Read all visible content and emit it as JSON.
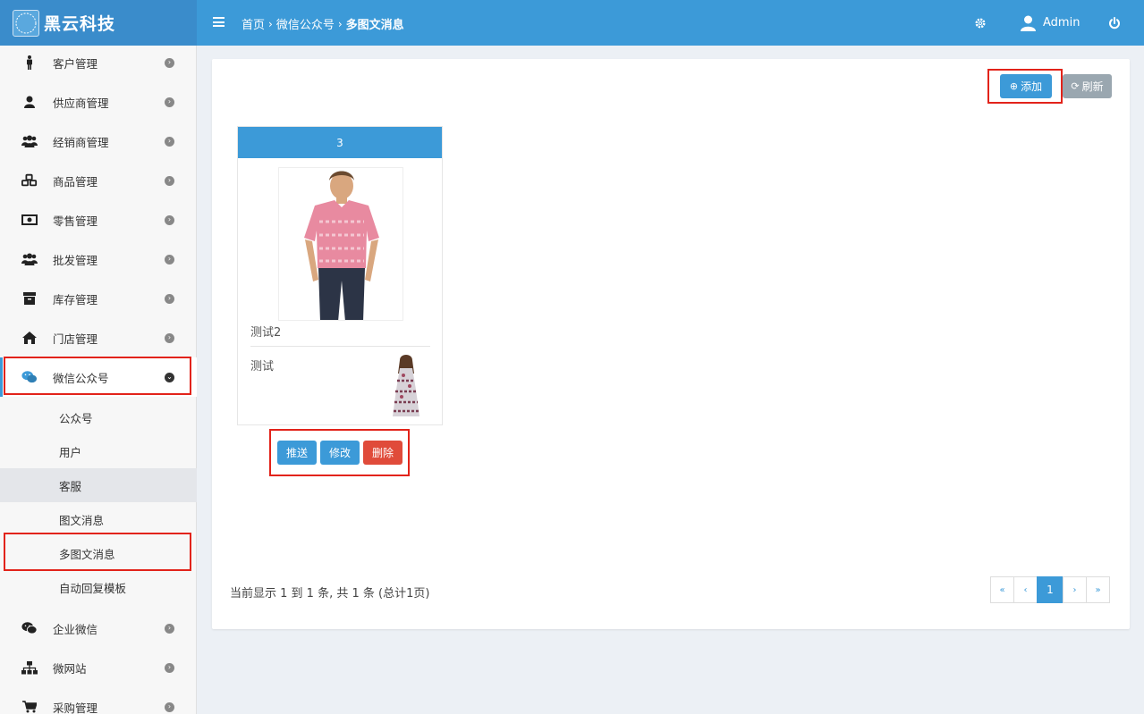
{
  "brand": {
    "logo_text": "黑云科技",
    "name": "黑云科技"
  },
  "header": {
    "breadcrumb": [
      "首页",
      "微信公众号",
      "多图文消息"
    ],
    "separator": "›",
    "user_name": "Admin"
  },
  "sidebar": {
    "items": [
      {
        "label": "客户管理",
        "icon": "male-icon"
      },
      {
        "label": "供应商管理",
        "icon": "user-icon"
      },
      {
        "label": "经销商管理",
        "icon": "users-icon"
      },
      {
        "label": "商品管理",
        "icon": "cubes-icon"
      },
      {
        "label": "零售管理",
        "icon": "money-icon"
      },
      {
        "label": "批发管理",
        "icon": "users-icon"
      },
      {
        "label": "库存管理",
        "icon": "archive-icon"
      },
      {
        "label": "门店管理",
        "icon": "home-icon"
      },
      {
        "label": "微信公众号",
        "icon": "wechat-icon"
      },
      {
        "label": "企业微信",
        "icon": "wechat-icon"
      },
      {
        "label": "微网站",
        "icon": "sitemap-icon"
      },
      {
        "label": "采购管理",
        "icon": "cart-icon"
      }
    ],
    "sub_items": [
      "公众号",
      "用户",
      "客服",
      "图文消息",
      "多图文消息",
      "自动回复模板"
    ]
  },
  "toolbar": {
    "add_label": "添加",
    "refresh_label": "刷新"
  },
  "card": {
    "header": "3",
    "title1": "测试2",
    "title2": "测试",
    "push_label": "推送",
    "edit_label": "修改",
    "delete_label": "删除"
  },
  "footer": {
    "info": "当前显示 1 到 1 条, 共 1 条 (总计1页)"
  },
  "pagination": {
    "first": "«",
    "prev": "‹",
    "current": "1",
    "next": "›",
    "last": "»"
  },
  "colors": {
    "primary": "#3c9ad8",
    "danger": "#e04b3a",
    "highlight": "#e2231a",
    "gray_button": "#9aa7b0"
  }
}
